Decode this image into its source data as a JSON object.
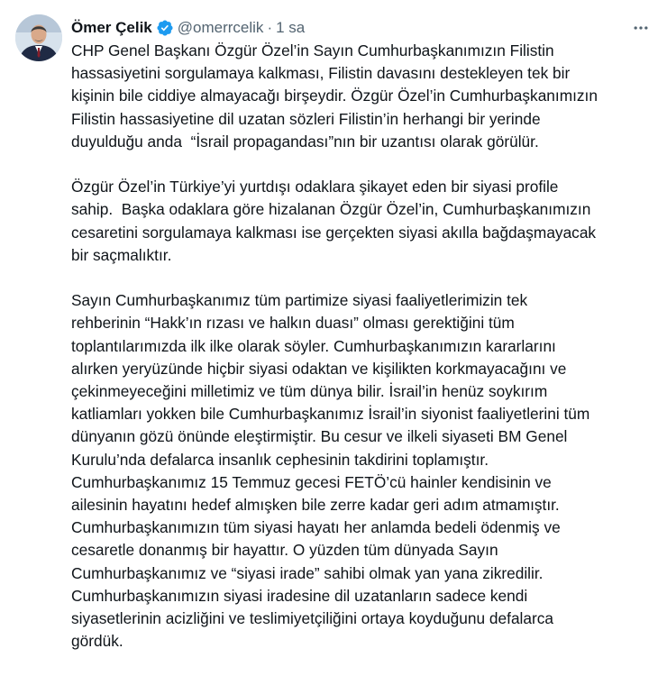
{
  "author": {
    "display_name": "Ömer Çelik",
    "handle": "@omerrcelik",
    "separator": "·",
    "time": "1 sa"
  },
  "colors": {
    "verified_blue": "#1d9bf0",
    "secondary_text": "#536471",
    "primary_text": "#0f1419"
  },
  "icons": {
    "verified": "verified-badge-icon",
    "more": "more-options-icon"
  },
  "tweet": {
    "paragraphs": [
      [
        "CHP Genel Başkanı Özgür Özel’in Sayın Cumhurbaşkanımızın Filistin",
        "hassasiyetini sorgulamaya kalkması, Filistin davasını destekleyen tek bir",
        "kişinin bile ciddiye almayacağı birşeydir. Özgür Özel’in Cumhurbaşkanımızın",
        "Filistin hassasiyetine dil uzatan sözleri Filistin’in herhangi bir yerinde",
        "duyulduğu anda  “İsrail propagandası”nın bir uzantısı olarak görülür."
      ],
      [
        "Özgür Özel’in Türkiye’yi yurtdışı odaklara şikayet eden bir siyasi profile",
        "sahip.  Başka odaklara göre hizalanan Özgür Özel’in, Cumhurbaşkanımızın",
        "cesaretini sorgulamaya kalkması ise gerçekten siyasi akılla bağdaşmayacak",
        "bir saçmalıktır."
      ],
      [
        "Sayın Cumhurbaşkanımız tüm partimize siyasi faaliyetlerimizin tek",
        "rehberinin “Hakk’ın rızası ve halkın duası” olması gerektiğini tüm",
        "toplantılarımızda ilk ilke olarak söyler. Cumhurbaşkanımızın kararlarını",
        "alırken yeryüzünde hiçbir siyasi odaktan ve kişilikten korkmayacağını ve",
        "çekinmeyeceğini milletimiz ve tüm dünya bilir. İsrail’in henüz soykırım",
        "katliamları yokken bile Cumhurbaşkanımız İsrail’in siyonist faaliyetlerini tüm",
        "dünyanın gözü önünde eleştirmiştir. Bu cesur ve ilkeli siyaseti BM Genel",
        "Kurulu’nda defalarca insanlık cephesinin takdirini toplamıştır.",
        "Cumhurbaşkanımız 15 Temmuz gecesi FETÖ’cü hainler kendisinin ve",
        "ailesinin hayatını hedef almışken bile zerre kadar geri adım atmamıştır.",
        "Cumhurbaşkanımızın tüm siyasi hayatı her anlamda bedeli ödenmiş ve",
        "cesaretle donanmış bir hayattır. O yüzden tüm dünyada Sayın",
        "Cumhurbaşkanımız ve “siyasi irade” sahibi olmak yan yana zikredilir.",
        "Cumhurbaşkanımızın siyasi iradesine dil uzatanların sadece kendi",
        "siyasetlerinin acizliğini ve teslimiyetçiliğini ortaya koyduğunu defalarca",
        "gördük."
      ]
    ]
  }
}
